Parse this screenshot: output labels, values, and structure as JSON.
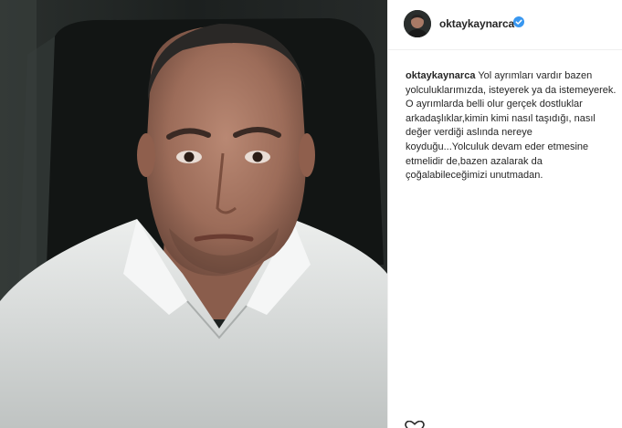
{
  "post": {
    "username": "oktaykaynarca",
    "verified": true,
    "caption_lines": [
      "Yol ayrımları vardır bazen",
      "yolculuklarımızda, isteyerek ya da istemeyerek.",
      "O ayrımlarda belli olur gerçek dostluklar",
      "arkadaşlıklar,kimin kimi nasıl taşıdığı, nasıl",
      "değer verdiği aslında nereye",
      "koyduğu...Yolculuk devam eder etmesine",
      "etmelidir de,bazen azalarak da",
      "çoğalabileceğimizi unutmadan."
    ]
  },
  "icons": {
    "verified": "verified-badge-icon",
    "footer": "heart-icon"
  },
  "colors": {
    "verified": "#3897f0",
    "text": "#262626",
    "divider": "#efefef"
  }
}
